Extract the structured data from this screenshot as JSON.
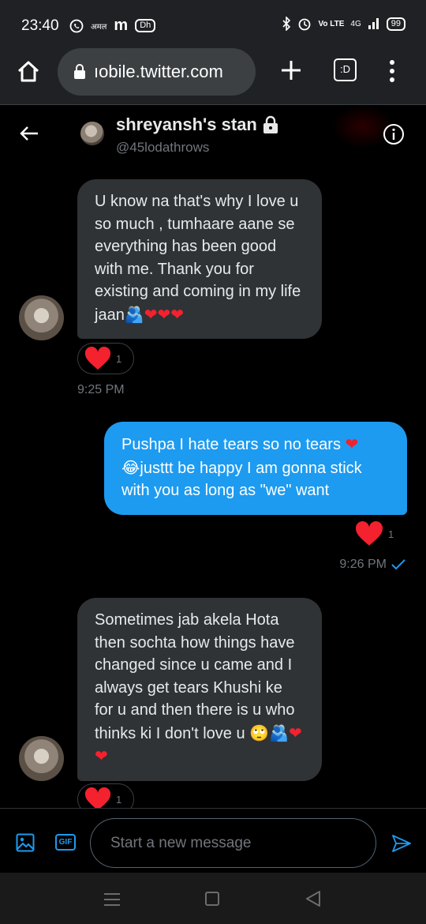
{
  "status_bar": {
    "time": "23:40",
    "left_badges": [
      "अमल",
      "m",
      "Dh"
    ],
    "network": "Vo LTE",
    "signal_text": "4G",
    "battery": "99"
  },
  "browser": {
    "url": "ıobile.twitter.com",
    "tabs_label": ":D"
  },
  "chat_header": {
    "name": "shreyansh's stan",
    "handle": "@45lodathrows"
  },
  "messages": [
    {
      "direction": "in",
      "text": "U know na  that's why I love u so much , tumhaare aane se everything has been good with me. Thank you for existing and coming in my life jaan",
      "emoji": "🫂❤❤❤",
      "reaction_count": "1",
      "time": "9:25 PM"
    },
    {
      "direction": "out",
      "text_1": "Pushpa I hate tears so no tears ",
      "emoji_1": "❤",
      "emoji_2": "😂",
      "text_2": "justtt  be happy I am gonna stick with you as long as \"we\" want",
      "reaction_count": "1",
      "time": "9:26 PM"
    },
    {
      "direction": "in",
      "text": "Sometimes jab akela Hota then sochta how things have changed since u came and I always get tears Khushi ke for u and then there is u who thinks ki I don't love u ",
      "emoji": "🙄🫂❤❤",
      "reaction_count": "1"
    }
  ],
  "composer": {
    "gif_label": "GIF",
    "placeholder": "Start a new message"
  },
  "colors": {
    "accent": "#1d9bf0",
    "bubble_in": "#2f3336",
    "heart": "#f4212e"
  },
  "icons": [
    "home-icon",
    "lock-icon",
    "plus-icon",
    "overflow-menu-icon",
    "back-arrow-icon",
    "info-icon",
    "media-icon",
    "send-icon",
    "heart-icon",
    "checkmark-icon"
  ]
}
